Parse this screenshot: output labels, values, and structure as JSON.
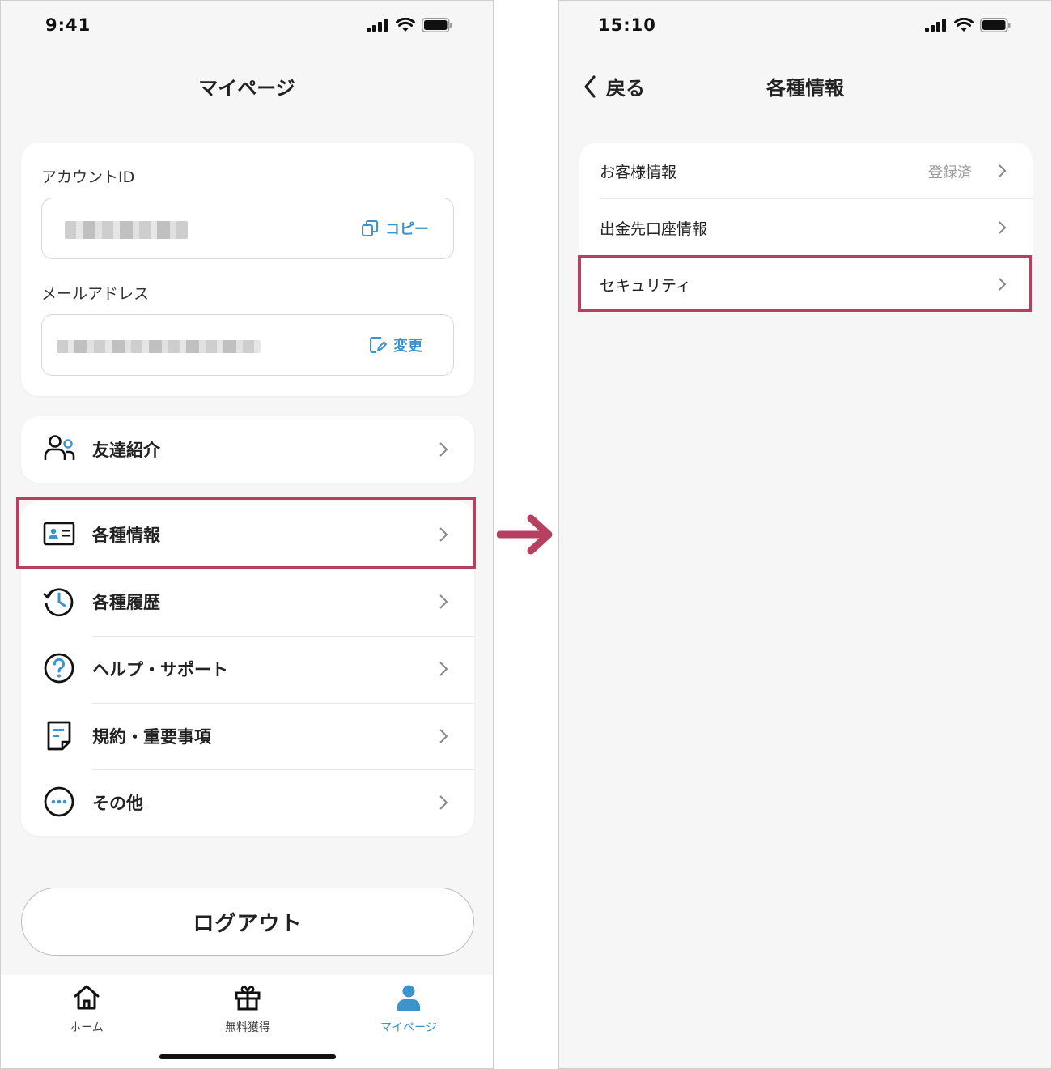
{
  "colors": {
    "accent": "#3a95cf",
    "highlight": "#b5405f",
    "text": "#222222"
  },
  "left_screen": {
    "status_time": "9:41",
    "title": "マイページ",
    "account": {
      "account_id_label": "アカウントID",
      "copy_label": "コピー",
      "email_label": "メールアドレス",
      "change_label": "変更"
    },
    "menu": {
      "referral": {
        "label": "友達紹介",
        "icon": "user-plus-icon"
      },
      "info": {
        "label": "各種情報",
        "icon": "id-card-icon"
      },
      "history": {
        "label": "各種履歴",
        "icon": "clock-history-icon"
      },
      "help": {
        "label": "ヘルプ・サポート",
        "icon": "question-circle-icon"
      },
      "terms": {
        "label": "規約・重要事項",
        "icon": "document-icon"
      },
      "other": {
        "label": "その他",
        "icon": "ellipsis-circle-icon"
      }
    },
    "logout_label": "ログアウト",
    "tabs": {
      "home": "ホーム",
      "free": "無料獲得",
      "mypage": "マイページ"
    }
  },
  "right_screen": {
    "status_time": "15:10",
    "back_label": "戻る",
    "title": "各種情報",
    "rows": {
      "customer": {
        "label": "お客様情報",
        "value": "登録済"
      },
      "bank": {
        "label": "出金先口座情報"
      },
      "security": {
        "label": "セキュリティ"
      }
    }
  }
}
